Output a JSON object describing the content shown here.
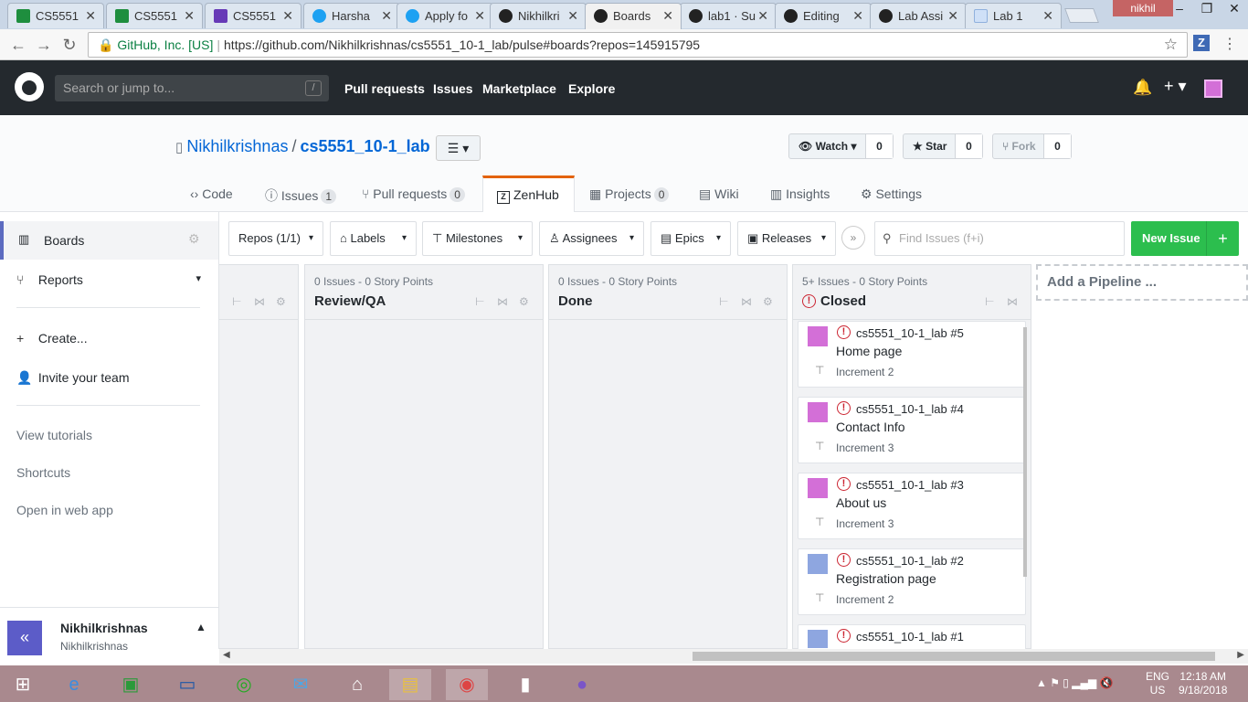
{
  "browser": {
    "tabs": [
      {
        "title": "CS5551",
        "icon": "sheets-icon"
      },
      {
        "title": "CS5551",
        "icon": "sheets-icon"
      },
      {
        "title": "CS5551",
        "icon": "forms-icon"
      },
      {
        "title": "Harsha",
        "icon": "twitter-icon"
      },
      {
        "title": "Apply fo",
        "icon": "twitter-icon"
      },
      {
        "title": "Nikhilkri",
        "icon": "github-icon"
      },
      {
        "title": "Boards",
        "icon": "github-icon"
      },
      {
        "title": "lab1 · Su",
        "icon": "github-icon"
      },
      {
        "title": "Editing",
        "icon": "github-icon"
      },
      {
        "title": "Lab Assi",
        "icon": "github-icon"
      },
      {
        "title": "Lab 1",
        "icon": "umkc-icon"
      }
    ],
    "user": "nikhil",
    "org": "GitHub, Inc. [US]",
    "url": "https://github.com/Nikhilkrishnas/cs5551_10-1_lab/pulse#boards?repos=145915795",
    "ext": "Z"
  },
  "gh": {
    "search_placeholder": "Search or jump to...",
    "slash": "/",
    "nav": [
      "Pull requests",
      "Issues",
      "Marketplace",
      "Explore"
    ]
  },
  "repo": {
    "owner": "Nikhilkrishnas",
    "slash": "/",
    "name": "cs5551_10-1_lab",
    "watch": "Watch",
    "watch_count": "0",
    "star": "Star",
    "star_count": "0",
    "fork": "Fork",
    "fork_count": "0",
    "tabs": {
      "code": "Code",
      "issues": "Issues",
      "issues_count": "1",
      "pulls": "Pull requests",
      "pulls_count": "0",
      "zenhub": "ZenHub",
      "projects": "Projects",
      "projects_count": "0",
      "wiki": "Wiki",
      "insights": "Insights",
      "settings": "Settings"
    }
  },
  "sidebar": {
    "boards": "Boards",
    "reports": "Reports",
    "create": "Create...",
    "invite": "Invite your team",
    "tutorials": "View tutorials",
    "shortcuts": "Shortcuts",
    "webapp": "Open in web app",
    "user_name": "Nikhilkrishnas",
    "user_login": "Nikhilkrishnas"
  },
  "filters": {
    "repos": "Repos (1/1)",
    "labels": "Labels",
    "milestones": "Milestones",
    "assignees": "Assignees",
    "epics": "Epics",
    "releases": "Releases",
    "find_placeholder": "Find Issues (f+i)",
    "new_issue": "New Issue"
  },
  "pipelines": [
    {
      "meta": "0 Issues - 0 Story Points",
      "name": "Review/QA"
    },
    {
      "meta": "0 Issues - 0 Story Points",
      "name": "Done"
    },
    {
      "meta": "5+ Issues - 0 Story Points",
      "name": "Closed"
    }
  ],
  "cards": [
    {
      "num": "cs5551_10-1_lab #5",
      "title": "Home page",
      "milestone": "Increment 2"
    },
    {
      "num": "cs5551_10-1_lab #4",
      "title": "Contact Info",
      "milestone": "Increment 3"
    },
    {
      "num": "cs5551_10-1_lab #3",
      "title": "About us",
      "milestone": "Increment 3"
    },
    {
      "num": "cs5551_10-1_lab #2",
      "title": "Registration page",
      "milestone": "Increment 2"
    },
    {
      "num": "cs5551_10-1_lab #1",
      "title": "",
      "milestone": ""
    }
  ],
  "add_pipeline": "Add a Pipeline ...",
  "taskbar": {
    "lang1": "ENG",
    "lang2": "US",
    "time": "12:18 AM",
    "date": "9/18/2018"
  }
}
